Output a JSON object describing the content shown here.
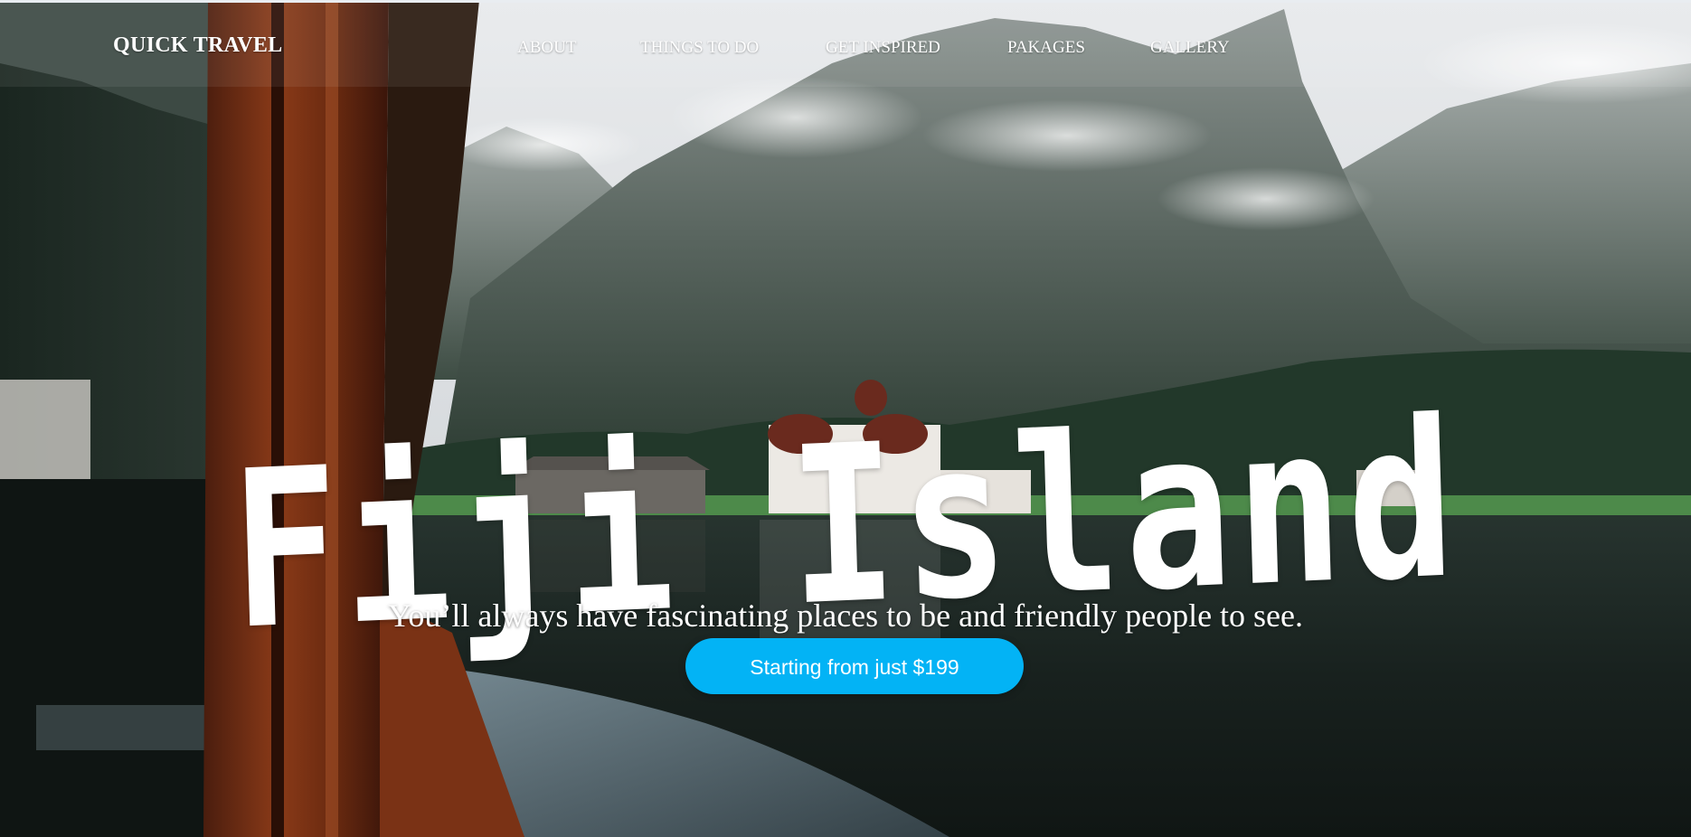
{
  "nav": {
    "brand": "QUICK TRAVEL",
    "links": [
      "ABOUT",
      "THINGS TO DO",
      "GET INSPIRED",
      "PAKAGES",
      "GALLERY"
    ]
  },
  "hero": {
    "title": "Fiji Island",
    "tagline": "You’ll always have fascinating places to be and friendly people to see.",
    "cta_label": "Starting from just $199"
  },
  "colors": {
    "cta_background": "#03b3f5",
    "text": "#ffffff"
  },
  "icons": []
}
